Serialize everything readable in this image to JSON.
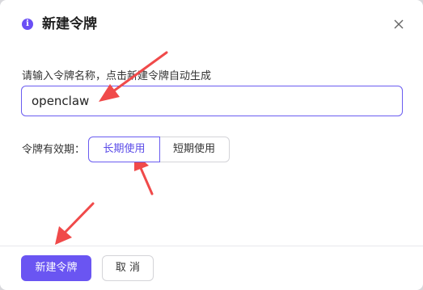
{
  "dialog": {
    "title": "新建令牌",
    "info_icon": "info-circle-icon",
    "close_icon": "close-icon"
  },
  "form": {
    "name_label": "请输入令牌名称，点击新建令牌自动生成",
    "name_value": "openclaw",
    "validity_label": "令牌有效期：",
    "validity_options": [
      {
        "label": "长期使用",
        "selected": true
      },
      {
        "label": "短期使用",
        "selected": false
      }
    ]
  },
  "footer": {
    "create_label": "新建令牌",
    "cancel_label": "取 消"
  },
  "colors": {
    "accent": "#6a55f2",
    "annotation_arrow": "#f04a4a"
  }
}
